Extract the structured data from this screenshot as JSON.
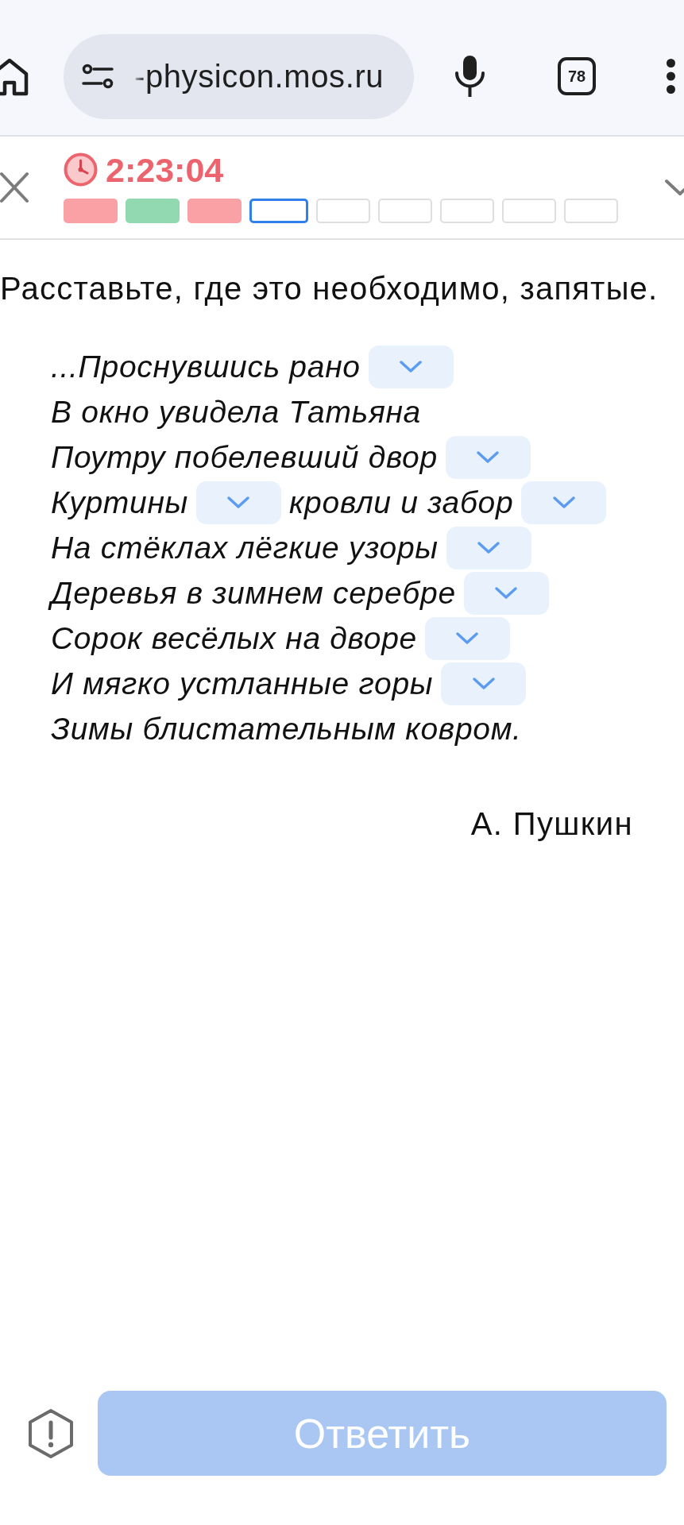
{
  "browser": {
    "url": "-physicon.mos.ru",
    "tab_count": "78"
  },
  "header": {
    "timer": "2:23:04",
    "questions": [
      {
        "color": "#f9a1a5",
        "selected": false
      },
      {
        "color": "#92d9b1",
        "selected": false
      },
      {
        "color": "#f9a1a5",
        "selected": false
      },
      {
        "color": "#ffffff",
        "selected": true
      },
      {
        "color": "#ffffff",
        "selected": false
      },
      {
        "color": "#ffffff",
        "selected": false
      },
      {
        "color": "#ffffff",
        "selected": false
      },
      {
        "color": "#ffffff",
        "selected": false
      },
      {
        "color": "#ffffff",
        "selected": false
      }
    ]
  },
  "task": {
    "instruction": "Расставьте, где это необходимо, запятые.",
    "poem": [
      {
        "parts": [
          {
            "kind": "text",
            "text": "...Проснувшись рано"
          },
          {
            "kind": "dropdown"
          }
        ]
      },
      {
        "parts": [
          {
            "kind": "text",
            "text": "В окно увидела Татьяна"
          }
        ]
      },
      {
        "parts": [
          {
            "kind": "text",
            "text": "Поутру побелевший двор"
          },
          {
            "kind": "dropdown"
          }
        ]
      },
      {
        "parts": [
          {
            "kind": "text",
            "text": "Куртины"
          },
          {
            "kind": "dropdown"
          },
          {
            "kind": "text",
            "text": "кровли и забор"
          },
          {
            "kind": "dropdown"
          }
        ]
      },
      {
        "parts": [
          {
            "kind": "text",
            "text": "На стёклах лёгкие узоры"
          },
          {
            "kind": "dropdown"
          }
        ]
      },
      {
        "parts": [
          {
            "kind": "text",
            "text": "Деревья в зимнем серебре"
          },
          {
            "kind": "dropdown"
          }
        ]
      },
      {
        "parts": [
          {
            "kind": "text",
            "text": "Сорок весёлых на дворе"
          },
          {
            "kind": "dropdown"
          }
        ]
      },
      {
        "parts": [
          {
            "kind": "text",
            "text": "И мягко устланные горы"
          },
          {
            "kind": "dropdown"
          }
        ]
      },
      {
        "parts": [
          {
            "kind": "text",
            "text": "Зимы блистательным ковром."
          }
        ]
      }
    ],
    "author": "А. Пушкин"
  },
  "footer": {
    "answer_button": {
      "label": "Ответить",
      "disabled": true
    }
  }
}
